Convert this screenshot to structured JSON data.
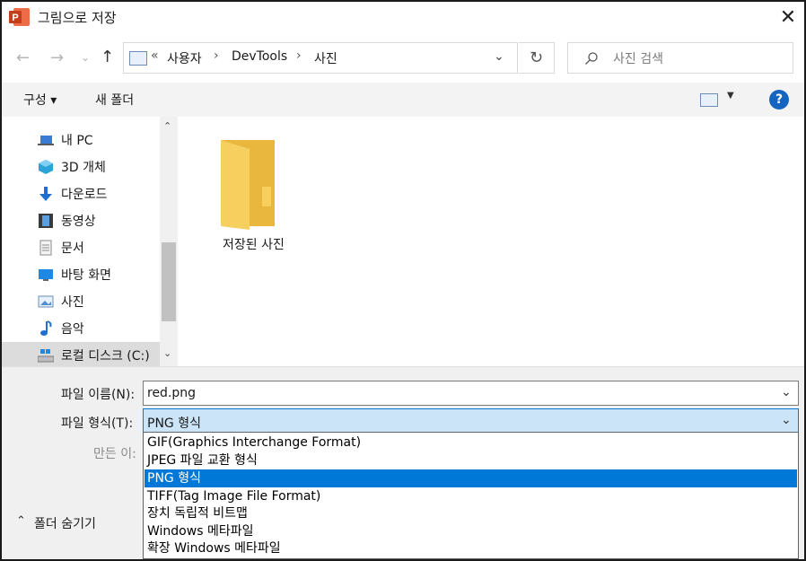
{
  "window": {
    "title": "그림으로 저장",
    "close_glyph": "✕"
  },
  "address": {
    "chevrons": "«",
    "crumbs": [
      "사용자",
      "DevTools",
      "사진"
    ],
    "separator": "›",
    "search_placeholder": "사진 검색"
  },
  "toolbar": {
    "organize": "구성 ▾",
    "new_folder": "새 폴더",
    "help": "?"
  },
  "nav": {
    "items": [
      {
        "label": "내 PC",
        "icon": "pc-icon"
      },
      {
        "label": "3D 개체",
        "icon": "cube-icon"
      },
      {
        "label": "다운로드",
        "icon": "download-icon"
      },
      {
        "label": "동영상",
        "icon": "video-icon"
      },
      {
        "label": "문서",
        "icon": "document-icon"
      },
      {
        "label": "바탕 화면",
        "icon": "desktop-icon"
      },
      {
        "label": "사진",
        "icon": "pictures-icon"
      },
      {
        "label": "음악",
        "icon": "music-icon"
      },
      {
        "label": "로컬 디스크 (C:)",
        "icon": "disk-icon"
      }
    ]
  },
  "content": {
    "folder_label": "저장된 사진"
  },
  "form": {
    "filename_label": "파일 이름(N):",
    "filename_value": "red.png",
    "filetype_label": "파일 형식(T):",
    "filetype_value": "PNG 형식",
    "author_label": "만든 이:",
    "hide_folders": "폴더 숨기기"
  },
  "filetype_options": [
    "GIF(Graphics Interchange Format)",
    "JPEG 파일 교환 형식",
    "PNG 형식",
    "TIFF(Tag Image File Format)",
    "장치 독립적 비트맵",
    "Windows 메타파일",
    "확장 Windows 메타파일"
  ],
  "selected_option_index": 2,
  "colors": {
    "accent": "#0078d7",
    "help_blue": "#1565c0",
    "folder": "#f6cf5f"
  }
}
